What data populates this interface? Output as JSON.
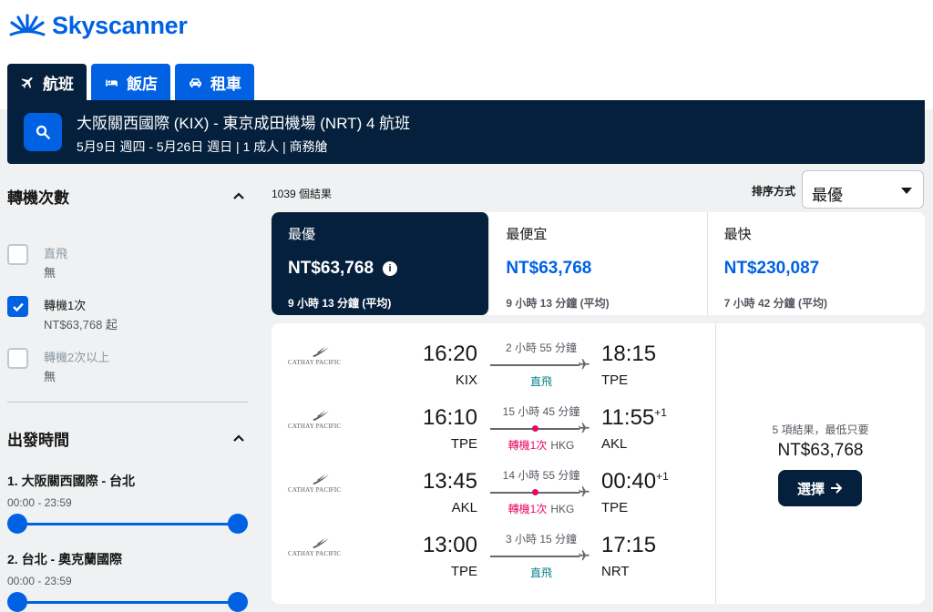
{
  "brand": {
    "name": "Skyscanner",
    "color": "#0062e3",
    "dark": "#05203c"
  },
  "tabs": [
    {
      "label": "航班",
      "icon": "plane-icon",
      "active": true
    },
    {
      "label": "飯店",
      "icon": "bed-icon",
      "active": false
    },
    {
      "label": "租車",
      "icon": "car-icon",
      "active": false
    }
  ],
  "search": {
    "route": "大阪關西國際 (KIX) - 東京成田機場 (NRT) 4 航班",
    "details": "5月9日 週四 - 5月26日 週日 | 1 成人 | 商務艙"
  },
  "filters": {
    "stops": {
      "title": "轉機次數",
      "options": [
        {
          "label": "直飛",
          "sub": "無",
          "checked": false,
          "disabled": true
        },
        {
          "label": "轉機1次",
          "sub": "NT$63,768 起",
          "checked": true,
          "disabled": false
        },
        {
          "label": "轉機2次以上",
          "sub": "無",
          "checked": false,
          "disabled": true
        }
      ]
    },
    "departure": {
      "title": "出發時間",
      "legs": [
        {
          "title": "1. 大阪關西國際 - 台北",
          "range": "00:00 - 23:59"
        },
        {
          "title": "2. 台北 - 奧克蘭國際",
          "range": "00:00 - 23:59"
        }
      ]
    }
  },
  "results": {
    "count": "1039 個結果",
    "sort_label": "排序方式",
    "sort_value": "最優",
    "sort_tabs": [
      {
        "title": "最優",
        "price": "NT$63,768",
        "sub": "9 小時 13 分鐘 (平均)",
        "active": true
      },
      {
        "title": "最便宜",
        "price": "NT$63,768",
        "sub": "9 小時 13 分鐘 (平均)",
        "active": false
      },
      {
        "title": "最快",
        "price": "NT$230,087",
        "sub": "7 小時 42 分鐘 (平均)",
        "active": false
      }
    ]
  },
  "itinerary": {
    "airline": "CATHAY PACIFIC",
    "segments": [
      {
        "dep_time": "16:20",
        "dep_code": "KIX",
        "arr_time": "18:15",
        "arr_plus": "",
        "arr_code": "TPE",
        "duration": "2 小時 55 分鐘",
        "stops": "直飛",
        "via": ""
      },
      {
        "dep_time": "16:10",
        "dep_code": "TPE",
        "arr_time": "11:55",
        "arr_plus": "+1",
        "arr_code": "AKL",
        "duration": "15 小時 45 分鐘",
        "stops": "轉機1次",
        "via": "HKG"
      },
      {
        "dep_time": "13:45",
        "dep_code": "AKL",
        "arr_time": "00:40",
        "arr_plus": "+1",
        "arr_code": "TPE",
        "duration": "14 小時 55 分鐘",
        "stops": "轉機1次",
        "via": "HKG"
      },
      {
        "dep_time": "13:00",
        "dep_code": "TPE",
        "arr_time": "17:15",
        "arr_plus": "",
        "arr_code": "NRT",
        "duration": "3 小時 15 分鐘",
        "stops": "直飛",
        "via": ""
      }
    ],
    "deals": "5 項結果，最低只要",
    "price": "NT$63,768",
    "select_label": "選擇"
  }
}
